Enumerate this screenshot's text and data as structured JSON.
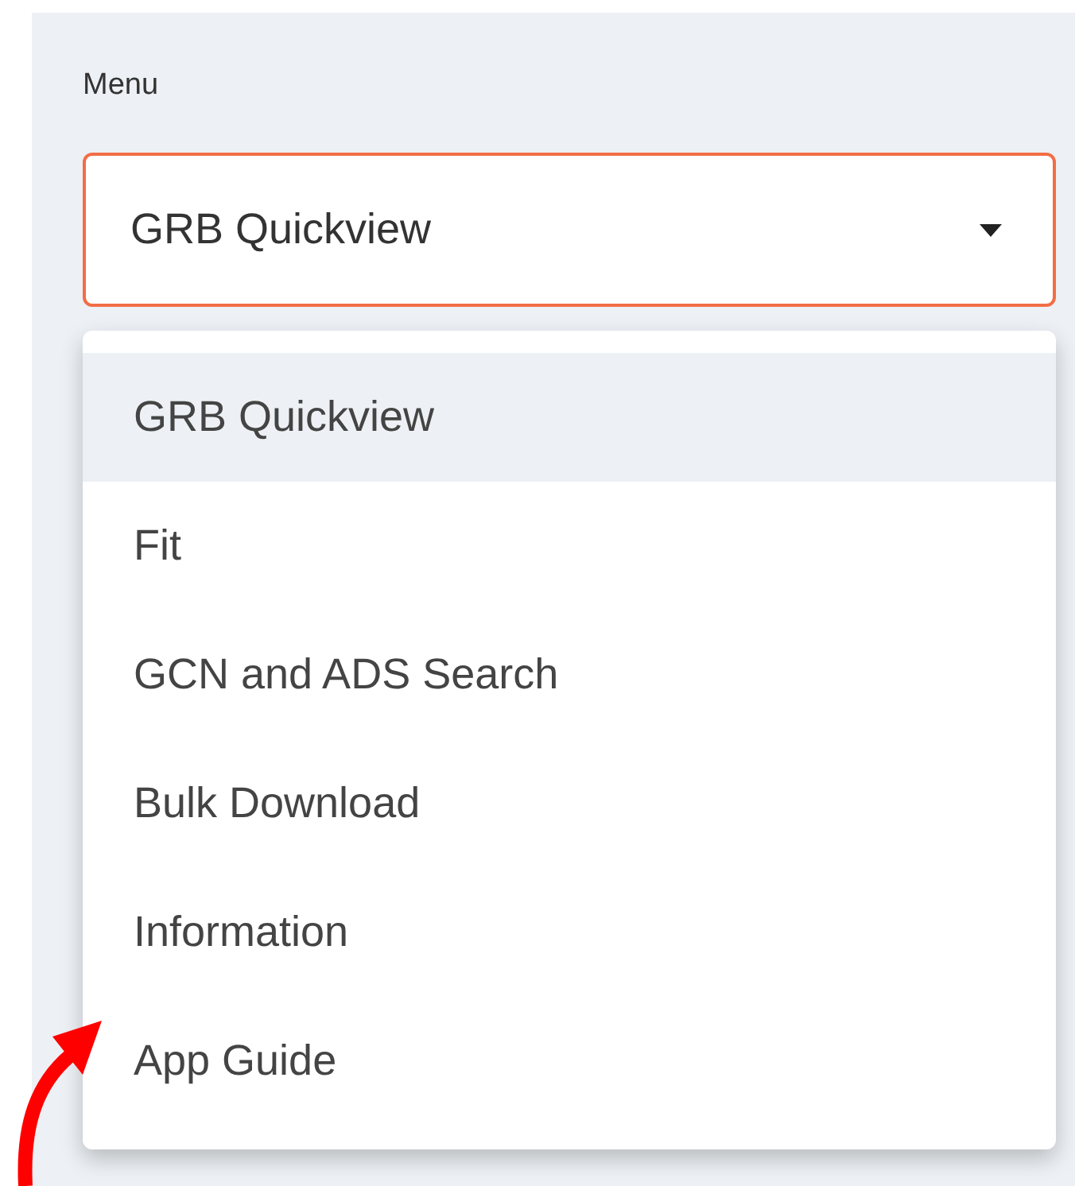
{
  "select": {
    "label": "Menu",
    "value": "GRB Quickview",
    "expanded": true
  },
  "options": [
    {
      "label": "GRB Quickview",
      "selected": true
    },
    {
      "label": "Fit",
      "selected": false
    },
    {
      "label": "GCN and ADS Search",
      "selected": false
    },
    {
      "label": "Bulk Download",
      "selected": false
    },
    {
      "label": "Information",
      "selected": false
    },
    {
      "label": "App Guide",
      "selected": false
    }
  ]
}
